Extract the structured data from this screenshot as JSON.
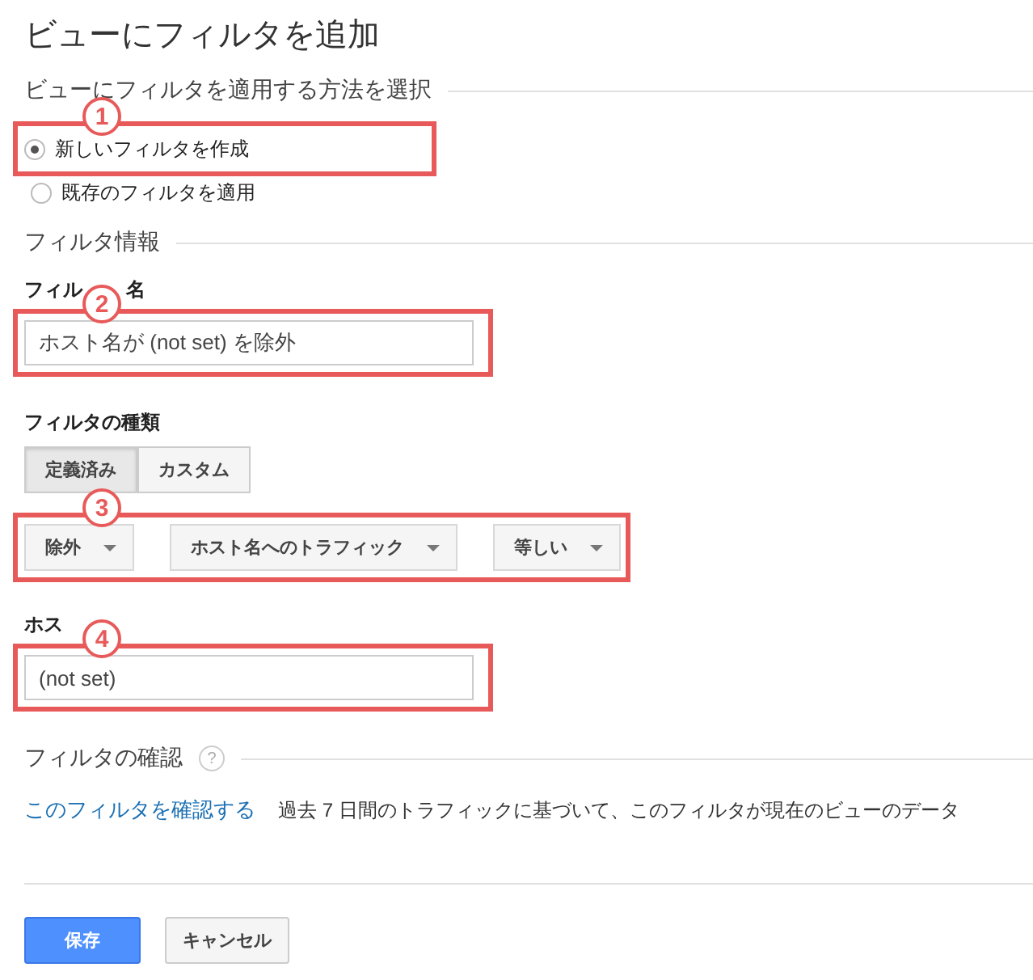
{
  "title": "ビューにフィルタを追加",
  "apply_section": {
    "heading": "ビューにフィルタを適用する方法を選択",
    "badge": "1",
    "options": [
      {
        "label": "新しいフィルタを作成",
        "selected": true
      },
      {
        "label": "既存のフィルタを適用",
        "selected": false
      }
    ]
  },
  "info_section": {
    "heading": "フィルタ情報"
  },
  "filter_name": {
    "label_parts": [
      "フィル",
      "名"
    ],
    "badge": "2",
    "value": "ホスト名が (not set) を除外"
  },
  "filter_type": {
    "label": "フィルタの種類",
    "tabs": [
      {
        "label": "定義済み",
        "selected": true
      },
      {
        "label": "カスタム",
        "selected": false
      }
    ]
  },
  "dropdowns": {
    "badge": "3",
    "items": [
      {
        "value": "除外"
      },
      {
        "value": "ホスト名へのトラフィック"
      },
      {
        "value": "等しい"
      }
    ]
  },
  "hostname": {
    "label_parts": [
      "ホス"
    ],
    "badge": "4",
    "value": "(not set)"
  },
  "verify_section": {
    "heading": "フィルタの確認",
    "help": "?",
    "link": "このフィルタを確認する",
    "description": "過去 7 日間のトラフィックに基づいて、このフィルタが現在のビューのデータ"
  },
  "buttons": [
    {
      "label": "保存",
      "kind": "primary"
    },
    {
      "label": "キャンセル",
      "kind": "secondary"
    }
  ]
}
